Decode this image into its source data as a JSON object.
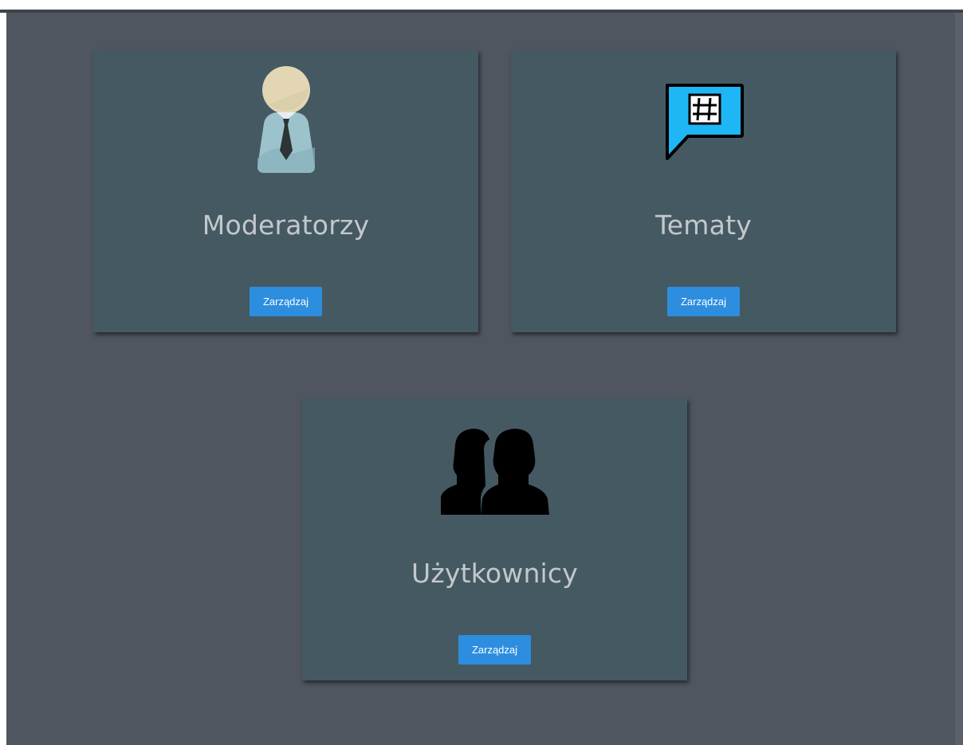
{
  "cards": [
    {
      "title": "Moderatorzy",
      "button_label": "Zarządzaj",
      "icon": "moderator-icon"
    },
    {
      "title": "Tematy",
      "button_label": "Zarządzaj",
      "icon": "hashtag-chat-icon"
    },
    {
      "title": "Użytkownicy",
      "button_label": "Zarządzaj",
      "icon": "users-icon"
    }
  ],
  "colors": {
    "page_background": "#505660",
    "card_background": "#455963",
    "title_text": "#c3c8cc",
    "button": "#2d8ee0",
    "button_text": "#ffffff",
    "chat_icon_fill": "#1fb6f5"
  }
}
